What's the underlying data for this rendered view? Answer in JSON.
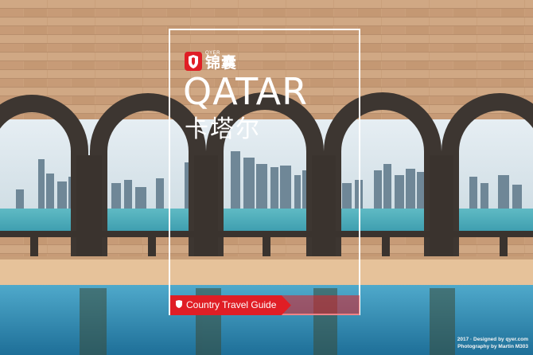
{
  "brand": {
    "small_text": "QYER",
    "name": "锦囊",
    "logo_icon": "qyer-logo-icon"
  },
  "cover": {
    "title": "QATAR",
    "subtitle": "卡塔尔",
    "guide_label": "Country Travel Guide",
    "guide_icon": "qyer-mini-logo-icon"
  },
  "credits": {
    "line1": "2017 · Designed by qyer.com",
    "line2": "Photography by Martin M303"
  },
  "colors": {
    "accent_red": "#e01e25",
    "frame_white": "#ffffff",
    "wall": "#c9a07c",
    "arch_stone": "#3d3631",
    "sky": "#dbe8ef",
    "sea": "#57b3c0",
    "pool": "#2d89b0"
  }
}
